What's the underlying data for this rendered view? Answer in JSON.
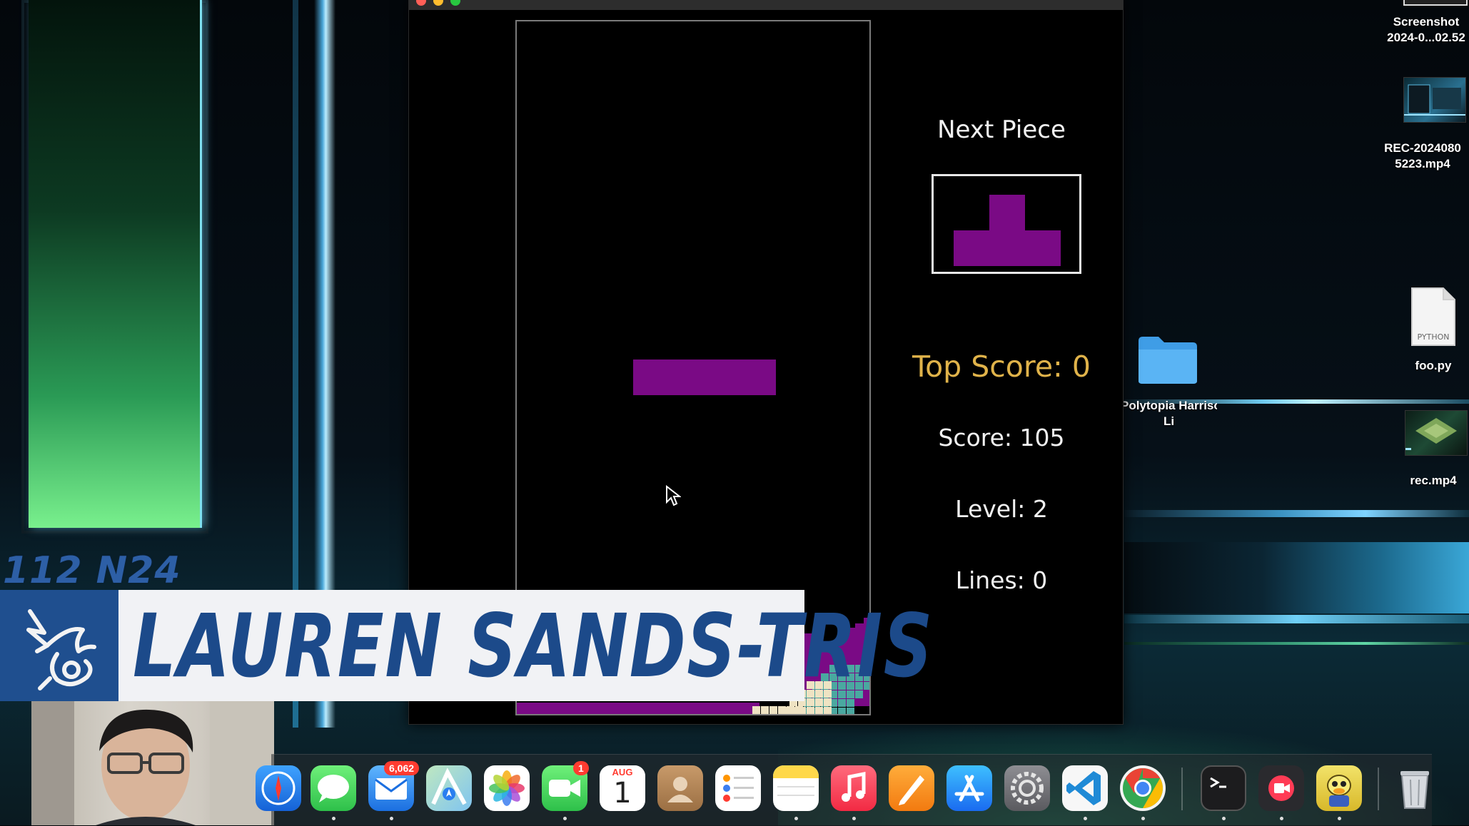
{
  "window": {
    "title": ""
  },
  "game": {
    "next_piece_title": "Next Piece",
    "top_score": "Top Score: 0",
    "score": "Score: 105",
    "level": "Level: 2",
    "lines": "Lines: 0",
    "colors": {
      "purple": "#7a0a85",
      "teal": "#4aa8a0",
      "cream": "#efe3c3",
      "top_score_gold": "#e0b34a"
    },
    "current_piece": "I",
    "next_piece": "T"
  },
  "desktop": {
    "files": [
      {
        "label_line1": "Screenshot",
        "label_line2": "2024-0...02.52",
        "icon": "screenshot-thumbnail-icon"
      },
      {
        "label_line1": "REC-2024080",
        "label_line2": "5223.mp4",
        "icon": "video-thumbnail-icon"
      },
      {
        "label_line1": "foo.py",
        "icon": "python-file-icon",
        "tag": "PYTHON"
      },
      {
        "label_line1": "Polytopia Harrison",
        "label_line2": "Li",
        "icon": "folder-icon"
      },
      {
        "label_line1": "rec.mp4",
        "icon": "video-thumbnail-icon"
      }
    ]
  },
  "overlay": {
    "code": "112 N24",
    "name": "LAUREN SANDS-TRIS"
  },
  "dock": {
    "mail_badge": "6,062",
    "facetime_badge": "1",
    "calendar_month": "AUG",
    "calendar_day": "1",
    "apps": [
      "safari-icon",
      "messages-icon",
      "mail-icon",
      "maps-icon",
      "photos-icon",
      "facetime-icon",
      "calendar-icon",
      "contacts-icon",
      "reminders-icon",
      "notes-icon",
      "music-icon",
      "pages-icon",
      "app-store-icon",
      "system-settings-icon",
      "vscode-icon",
      "chrome-icon",
      "terminal-icon",
      "screen-recorder-icon",
      "cyberduck-icon",
      "trash-icon"
    ]
  }
}
